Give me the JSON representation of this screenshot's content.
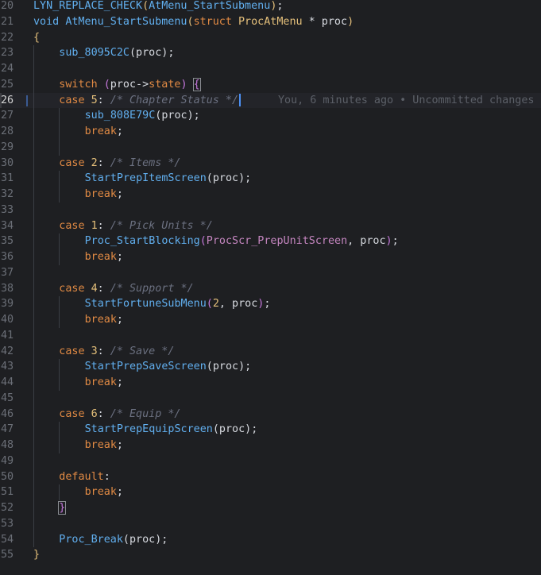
{
  "editor": {
    "lines": [
      {
        "num": "20",
        "indent": 0,
        "parts": [
          {
            "t": "LYN_REPLACE_CHECK",
            "c": "fn"
          },
          {
            "t": "(",
            "c": "br1"
          },
          {
            "t": "AtMenu_StartSubmenu",
            "c": "fn"
          },
          {
            "t": ")",
            "c": "br1"
          },
          {
            "t": ";",
            "c": "pl"
          }
        ]
      },
      {
        "num": "21",
        "indent": 0,
        "parts": [
          {
            "t": "void ",
            "c": "fn"
          },
          {
            "t": "AtMenu_StartSubmenu",
            "c": "fn"
          },
          {
            "t": "(",
            "c": "br1"
          },
          {
            "t": "struct ",
            "c": "kw"
          },
          {
            "t": "ProcAtMenu",
            "c": "ty"
          },
          {
            "t": " * proc",
            "c": "pl"
          },
          {
            "t": ")",
            "c": "br1"
          }
        ]
      },
      {
        "num": "22",
        "indent": 0,
        "parts": [
          {
            "t": "{",
            "c": "br1"
          }
        ]
      },
      {
        "num": "23",
        "indent": 1,
        "parts": [
          {
            "t": "sub_8095C2C",
            "c": "fn"
          },
          {
            "t": "(proc);",
            "c": "pl"
          }
        ]
      },
      {
        "num": "24",
        "indent": 1,
        "parts": []
      },
      {
        "num": "25",
        "indent": 1,
        "parts": [
          {
            "t": "switch ",
            "c": "kw"
          },
          {
            "t": "(",
            "c": "br2"
          },
          {
            "t": "proc->",
            "c": "pl"
          },
          {
            "t": "state",
            "c": "kw"
          },
          {
            "t": ")",
            "c": "br2"
          },
          {
            "t": " ",
            "c": "pl"
          },
          {
            "t": "{",
            "c": "br2",
            "box": true
          }
        ]
      },
      {
        "num": "26",
        "indent": 1,
        "current": true,
        "parts": [
          {
            "t": "case ",
            "c": "kw"
          },
          {
            "t": "5",
            "c": "num"
          },
          {
            "t": ": ",
            "c": "pl"
          },
          {
            "t": "/* Chapter Status */",
            "c": "cm"
          }
        ],
        "cursor": true,
        "blame": "You, 6 minutes ago • Uncommitted changes"
      },
      {
        "num": "27",
        "indent": 2,
        "parts": [
          {
            "t": "sub_808E79C",
            "c": "fn"
          },
          {
            "t": "(proc);",
            "c": "pl"
          }
        ]
      },
      {
        "num": "28",
        "indent": 2,
        "parts": [
          {
            "t": "break",
            "c": "kw"
          },
          {
            "t": ";",
            "c": "pl"
          }
        ]
      },
      {
        "num": "29",
        "indent": 2,
        "parts": []
      },
      {
        "num": "30",
        "indent": 1,
        "parts": [
          {
            "t": "case ",
            "c": "kw"
          },
          {
            "t": "2",
            "c": "num"
          },
          {
            "t": ": ",
            "c": "pl"
          },
          {
            "t": "/* Items */",
            "c": "cm"
          }
        ]
      },
      {
        "num": "31",
        "indent": 2,
        "parts": [
          {
            "t": "StartPrepItemScreen",
            "c": "fn"
          },
          {
            "t": "(proc);",
            "c": "pl"
          }
        ]
      },
      {
        "num": "32",
        "indent": 2,
        "parts": [
          {
            "t": "break",
            "c": "kw"
          },
          {
            "t": ";",
            "c": "pl"
          }
        ]
      },
      {
        "num": "33",
        "indent": 1,
        "parts": []
      },
      {
        "num": "34",
        "indent": 1,
        "parts": [
          {
            "t": "case ",
            "c": "kw"
          },
          {
            "t": "1",
            "c": "num"
          },
          {
            "t": ": ",
            "c": "pl"
          },
          {
            "t": "/* Pick Units */",
            "c": "cm"
          }
        ]
      },
      {
        "num": "35",
        "indent": 2,
        "parts": [
          {
            "t": "Proc_StartBlocking",
            "c": "fn"
          },
          {
            "t": "(",
            "c": "br2"
          },
          {
            "t": "ProcScr_PrepUnitScreen",
            "c": "mac"
          },
          {
            "t": ", proc",
            "c": "pl"
          },
          {
            "t": ")",
            "c": "br2"
          },
          {
            "t": ";",
            "c": "pl"
          }
        ]
      },
      {
        "num": "36",
        "indent": 2,
        "parts": [
          {
            "t": "break",
            "c": "kw"
          },
          {
            "t": ";",
            "c": "pl"
          }
        ]
      },
      {
        "num": "37",
        "indent": 1,
        "parts": []
      },
      {
        "num": "38",
        "indent": 1,
        "parts": [
          {
            "t": "case ",
            "c": "kw"
          },
          {
            "t": "4",
            "c": "num"
          },
          {
            "t": ": ",
            "c": "pl"
          },
          {
            "t": "/* Support */",
            "c": "cm"
          }
        ]
      },
      {
        "num": "39",
        "indent": 2,
        "parts": [
          {
            "t": "StartFortuneSubMenu",
            "c": "fn"
          },
          {
            "t": "(",
            "c": "br2"
          },
          {
            "t": "2",
            "c": "num"
          },
          {
            "t": ", proc",
            "c": "pl"
          },
          {
            "t": ")",
            "c": "br2"
          },
          {
            "t": ";",
            "c": "pl"
          }
        ]
      },
      {
        "num": "40",
        "indent": 2,
        "parts": [
          {
            "t": "break",
            "c": "kw"
          },
          {
            "t": ";",
            "c": "pl"
          }
        ]
      },
      {
        "num": "41",
        "indent": 1,
        "parts": []
      },
      {
        "num": "42",
        "indent": 1,
        "parts": [
          {
            "t": "case ",
            "c": "kw"
          },
          {
            "t": "3",
            "c": "num"
          },
          {
            "t": ": ",
            "c": "pl"
          },
          {
            "t": "/* Save */",
            "c": "cm"
          }
        ]
      },
      {
        "num": "43",
        "indent": 2,
        "parts": [
          {
            "t": "StartPrepSaveScreen",
            "c": "fn"
          },
          {
            "t": "(proc);",
            "c": "pl"
          }
        ]
      },
      {
        "num": "44",
        "indent": 2,
        "parts": [
          {
            "t": "break",
            "c": "kw"
          },
          {
            "t": ";",
            "c": "pl"
          }
        ]
      },
      {
        "num": "45",
        "indent": 1,
        "parts": []
      },
      {
        "num": "46",
        "indent": 1,
        "parts": [
          {
            "t": "case ",
            "c": "kw"
          },
          {
            "t": "6",
            "c": "num"
          },
          {
            "t": ": ",
            "c": "pl"
          },
          {
            "t": "/* Equip */",
            "c": "cm"
          }
        ]
      },
      {
        "num": "47",
        "indent": 2,
        "parts": [
          {
            "t": "StartPrepEquipScreen",
            "c": "fn"
          },
          {
            "t": "(proc);",
            "c": "pl"
          }
        ]
      },
      {
        "num": "48",
        "indent": 2,
        "parts": [
          {
            "t": "break",
            "c": "kw"
          },
          {
            "t": ";",
            "c": "pl"
          }
        ]
      },
      {
        "num": "49",
        "indent": 1,
        "parts": []
      },
      {
        "num": "50",
        "indent": 1,
        "parts": [
          {
            "t": "default",
            "c": "kw"
          },
          {
            "t": ":",
            "c": "pl"
          }
        ]
      },
      {
        "num": "51",
        "indent": 2,
        "parts": [
          {
            "t": "break",
            "c": "kw"
          },
          {
            "t": ";",
            "c": "pl"
          }
        ]
      },
      {
        "num": "52",
        "indent": 1,
        "parts": [
          {
            "t": "}",
            "c": "br2",
            "box": true
          }
        ]
      },
      {
        "num": "53",
        "indent": 1,
        "parts": []
      },
      {
        "num": "54",
        "indent": 1,
        "parts": [
          {
            "t": "Proc_Break",
            "c": "fn"
          },
          {
            "t": "(proc);",
            "c": "pl"
          }
        ]
      },
      {
        "num": "55",
        "indent": 0,
        "parts": [
          {
            "t": "}",
            "c": "br1"
          }
        ]
      }
    ]
  }
}
